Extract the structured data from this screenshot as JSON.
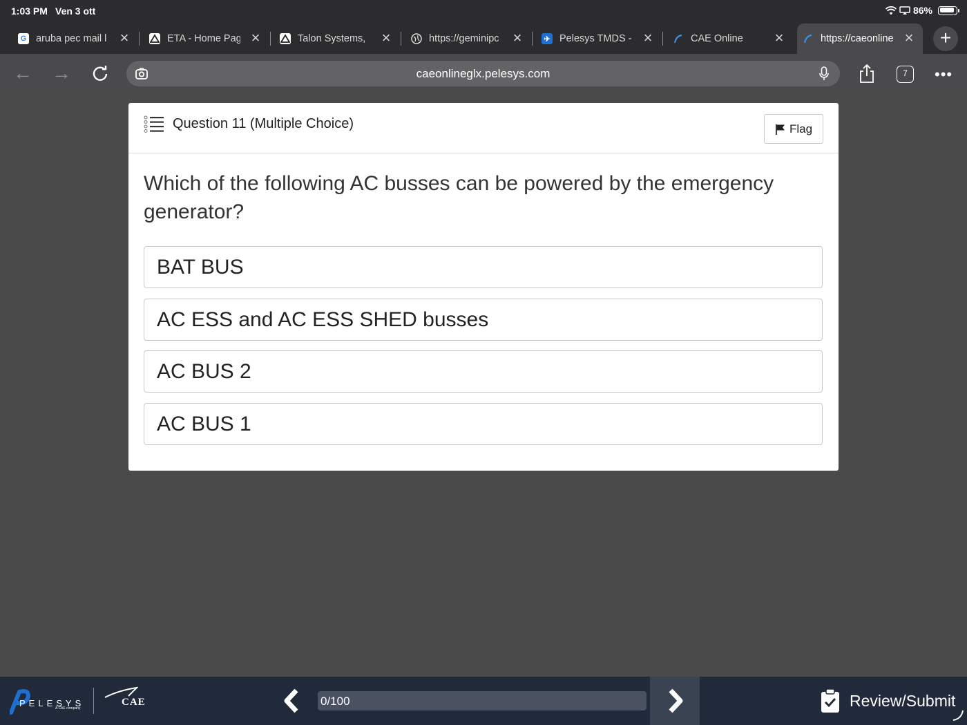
{
  "status": {
    "time": "1:03 PM",
    "date": "Ven 3 ott",
    "battery": "86%"
  },
  "tabs": [
    {
      "title": "aruba pec mail l",
      "icon": "google-icon",
      "active": false
    },
    {
      "title": "ETA - Home Pag",
      "icon": "eta-icon",
      "active": false
    },
    {
      "title": "Talon Systems,",
      "icon": "talon-icon",
      "active": false
    },
    {
      "title": "https://geminipc",
      "icon": "globe-icon",
      "active": false
    },
    {
      "title": "Pelesys TMDS -",
      "icon": "pelesys-plane-icon",
      "active": false
    },
    {
      "title": "CAE Online",
      "icon": "cae-icon",
      "active": false
    },
    {
      "title": "https://caeonline",
      "icon": "cae-icon",
      "active": true
    }
  ],
  "address_bar": {
    "url": "caeonlineglx.pelesys.com"
  },
  "tab_count": "7",
  "question": {
    "header": "Question 11 (Multiple Choice)",
    "flag_label": "Flag",
    "text": "Which of the following AC busses can be powered by the emergency generator?",
    "options": [
      "BAT BUS",
      "AC ESS and AC ESS SHED busses",
      "AC BUS 2",
      "AC BUS 1"
    ]
  },
  "footer": {
    "brand": "PELESYS",
    "brand_sub": "A CAE company",
    "partner": "CAE",
    "progress_text": "0/100",
    "progress": 0,
    "review_label": "Review/Submit"
  },
  "colors": {
    "page_bg": "#4a4a4a",
    "footer_bg": "#212a3a",
    "accent_blue": "#1f6fd1"
  }
}
